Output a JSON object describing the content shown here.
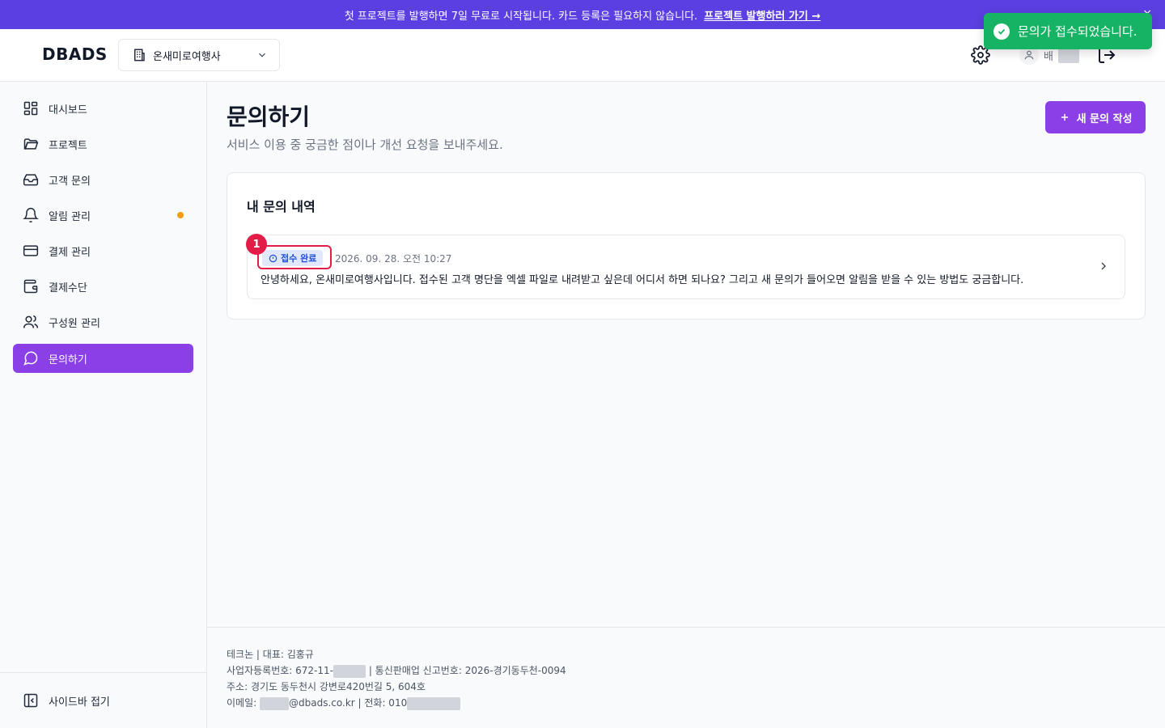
{
  "banner": {
    "text": "첫 프로젝트를 발행하면 7일 무료로 시작됩니다. 카드 등록은 필요하지 않습니다.",
    "link": "프로젝트 발행하러 가기 →",
    "close": "×"
  },
  "header": {
    "logo": "DBADS",
    "org": "온새미로여행사",
    "user_name": "배"
  },
  "toast": {
    "message": "문의가 접수되었습니다."
  },
  "sidebar": {
    "items": [
      {
        "label": "대시보드",
        "icon": "dashboard-icon"
      },
      {
        "label": "프로젝트",
        "icon": "folder-icon"
      },
      {
        "label": "고객 문의",
        "icon": "inbox-icon"
      },
      {
        "label": "알림 관리",
        "icon": "bell-icon"
      },
      {
        "label": "결제 관리",
        "icon": "credit-card-icon"
      },
      {
        "label": "결제수단",
        "icon": "wallet-icon"
      },
      {
        "label": "구성원 관리",
        "icon": "users-icon"
      },
      {
        "label": "문의하기",
        "icon": "chat-icon"
      }
    ],
    "collapse_label": "사이드바 접기"
  },
  "main": {
    "title": "문의하기",
    "subtitle": "서비스 이용 중 궁금한 점이나 개선 요청을 보내주세요.",
    "new_button": "새 문의 작성",
    "card_title": "내 문의 내역",
    "inquiries": [
      {
        "status": "접수 완료",
        "date": "2026. 09. 28. 오전 10:27",
        "text": "안녕하세요, 온새미로여행사입니다. 접수된 고객 명단을 엑셀 파일로 내려받고 싶은데 어디서 하면 되나요? 그리고 새 문의가 들어오면 알림을 받을 수 있는 방법도 궁금합니다.",
        "marker": "1"
      }
    ]
  },
  "footer": {
    "company": "테크논 | 대표: 김홍규",
    "biz_prefix": "사업자등록번호: 672-11-",
    "biz_suffix": "| 통신판매업 신고번호: 2026-경기동두천-0094",
    "address": "주소: 경기도 동두천시 강변로420번길 5, 604호",
    "email_prefix": "이메일:",
    "email_suffix": "@dbads.co.kr | 전화: 010"
  },
  "colors": {
    "accent": "#8b3fe6",
    "banner": "#5b3fe0",
    "toast": "#16b364",
    "marker": "#e11d48"
  }
}
